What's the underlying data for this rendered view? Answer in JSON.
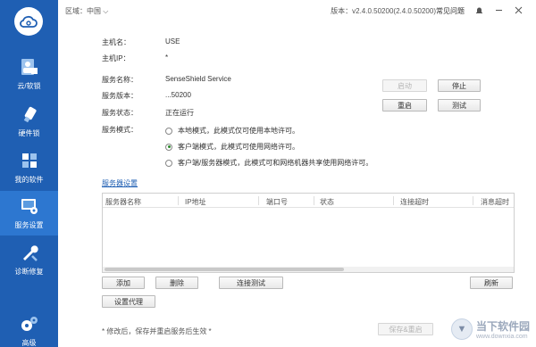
{
  "sidebar": {
    "items": [
      {
        "label": "云/软锁",
        "icon": "user-lock-icon"
      },
      {
        "label": "硬件锁",
        "icon": "usb-key-icon"
      },
      {
        "label": "我的软件",
        "icon": "cubes-icon"
      },
      {
        "label": "服务设置",
        "icon": "server-settings-icon"
      },
      {
        "label": "诊断修复",
        "icon": "wrench-icon"
      },
      {
        "label": "高级",
        "icon": "gears-icon"
      }
    ],
    "active_index": 3
  },
  "topbar": {
    "region": "区域：中国",
    "version": "版本：v2.4.0.50200(2.4.0.50200)",
    "faq": "常见问题"
  },
  "info": {
    "host_label": "主机名：",
    "host_value": "USE",
    "ip_label": "主机IP：",
    "ip_value": "*",
    "service_name_label": "服务名称：",
    "service_name_value": "SenseShield Service",
    "service_version_label": "服务版本：",
    "service_version_value": "...50200",
    "service_status_label": "服务状态：",
    "service_status_value": "正在运行",
    "service_mode_label": "服务模式："
  },
  "buttons": {
    "start": "启动",
    "stop": "停止",
    "restart": "重启",
    "test": "测试",
    "add": "添加",
    "delete": "删除",
    "connect_test": "连接测试",
    "refresh": "刷新",
    "proxy": "设置代理",
    "save_restart": "保存&重启"
  },
  "modes": [
    {
      "label": "本地模式，此模式仅可使用本地许可。",
      "selected": false
    },
    {
      "label": "客户端模式，此模式可使用网络许可。",
      "selected": true
    },
    {
      "label": "客户端/服务器模式，此模式可和网络机器共享使用网络许可。",
      "selected": false
    }
  ],
  "server_settings_link": "服务器设置",
  "table": {
    "columns": [
      "服务器名称",
      "IP地址",
      "端口号",
      "状态",
      "连接超时",
      "消息超时"
    ]
  },
  "footnote": "* 修改后，保存并重启服务后生效 *",
  "watermark": {
    "title": "当下软件园",
    "sub": "www.downxia.com"
  }
}
